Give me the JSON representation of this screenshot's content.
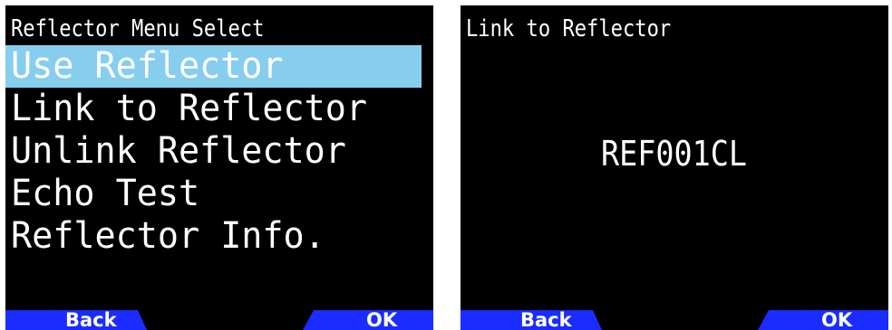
{
  "left_screen": {
    "title": "Reflector Menu Select",
    "menu_items": [
      {
        "label": "Use Reflector",
        "selected": true
      },
      {
        "label": "Link to Reflector",
        "selected": false
      },
      {
        "label": "Unlink Reflector",
        "selected": false
      },
      {
        "label": "Echo Test",
        "selected": false
      },
      {
        "label": "Reflector Info.",
        "selected": false
      }
    ],
    "softkeys": {
      "back": "Back",
      "ok": "OK"
    }
  },
  "right_screen": {
    "title": "Link to Reflector",
    "value": "REF001CL",
    "softkeys": {
      "back": "Back",
      "ok": "OK"
    }
  },
  "colors": {
    "screen_background": "#000000",
    "text": "#ffffff",
    "selection_highlight": "#87cdee",
    "softkey_background": "#1a2cff"
  }
}
